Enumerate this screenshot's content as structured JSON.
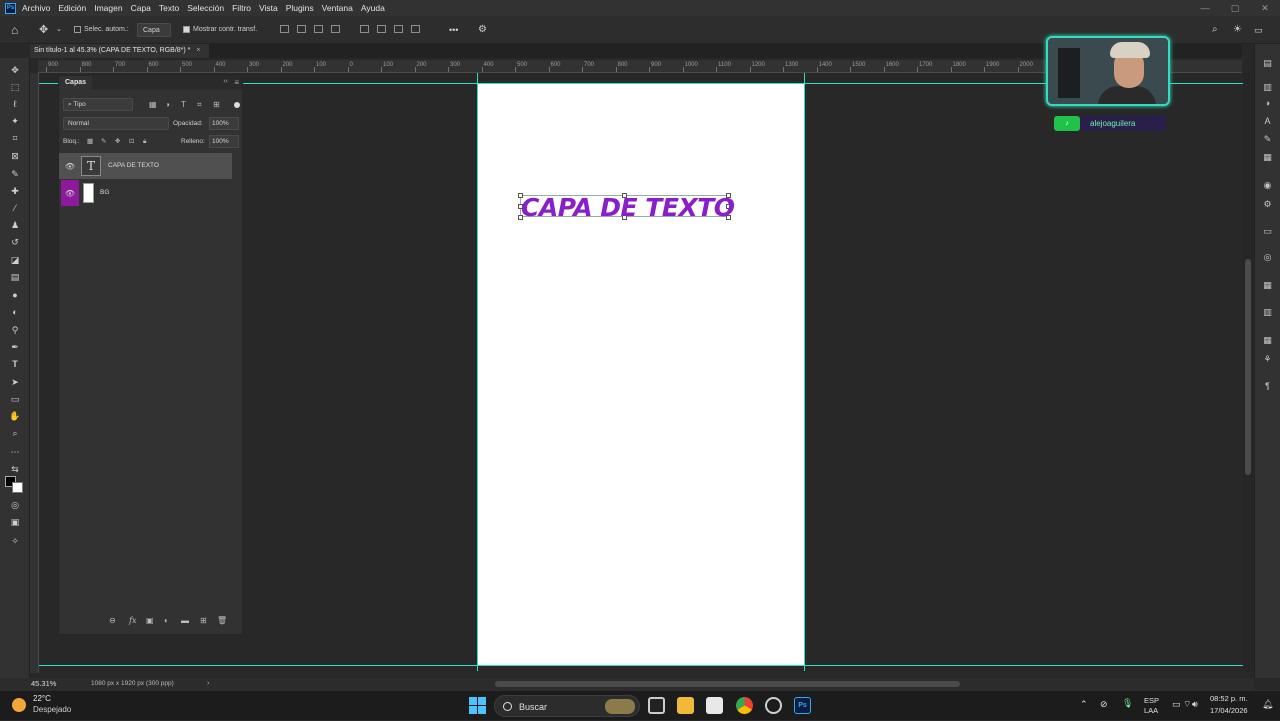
{
  "app": {
    "logo_text": "Ps"
  },
  "menu": [
    "Archivo",
    "Edición",
    "Imagen",
    "Capa",
    "Texto",
    "Selección",
    "Filtro",
    "Vista",
    "Plugins",
    "Ventana",
    "Ayuda"
  ],
  "window_controls": [
    "—",
    "▢",
    "✕"
  ],
  "options_bar": {
    "auto_select_label": "Selec. autom.:",
    "auto_select_value": "Capa",
    "show_transform_label": "Mostrar contr. transf.",
    "more_label": "•••"
  },
  "document_tab": {
    "title": "Sin título-1 al 45.3% (CAPA DE TEXTO, RGB/8*) *",
    "close": "×"
  },
  "ruler_ticks": [
    "900",
    "800",
    "700",
    "600",
    "500",
    "400",
    "300",
    "200",
    "100",
    "0",
    "100",
    "200",
    "300",
    "400",
    "500",
    "600",
    "700",
    "800",
    "900",
    "1000",
    "1100",
    "1200",
    "1300",
    "1400",
    "1500",
    "1600",
    "1700",
    "1800",
    "1900",
    "2000",
    "2100",
    "2200"
  ],
  "canvas": {
    "text": "CAPA DE TEXTO",
    "text_color": "#8a1fc9",
    "guide_color": "#2ee0c8"
  },
  "layers_panel": {
    "tab_label": "Capas",
    "filter_label": "Tipo",
    "blend_mode": "Normal",
    "opacity_label": "Opacidad:",
    "opacity_value": "100%",
    "lock_label": "Bloq.:",
    "fill_label": "Relleno:",
    "fill_value": "100%",
    "layers": [
      {
        "name": "CAPA DE TEXTO",
        "type": "text",
        "selected": true
      },
      {
        "name": "BG",
        "type": "fill",
        "eye_color": "#8d1a9a"
      }
    ],
    "bottom_icons": [
      "link-icon",
      "fx-icon",
      "mask-icon",
      "adjustment-icon",
      "group-icon",
      "new-layer-icon",
      "trash-icon"
    ],
    "fx_label": "fx"
  },
  "status": {
    "zoom": "45.31%",
    "doc_size": "1080 px x 1920 px (300 ppp)",
    "arrow": "›"
  },
  "stream_overlay": {
    "username": "alejoaguilera"
  },
  "taskbar": {
    "weather_temp": "22°C",
    "weather_desc": "Despejado",
    "search_label": "Buscar",
    "lang_1": "ESP",
    "lang_2": "LAA",
    "time": "08:52 p. m.",
    "date": "17/04/2026"
  }
}
